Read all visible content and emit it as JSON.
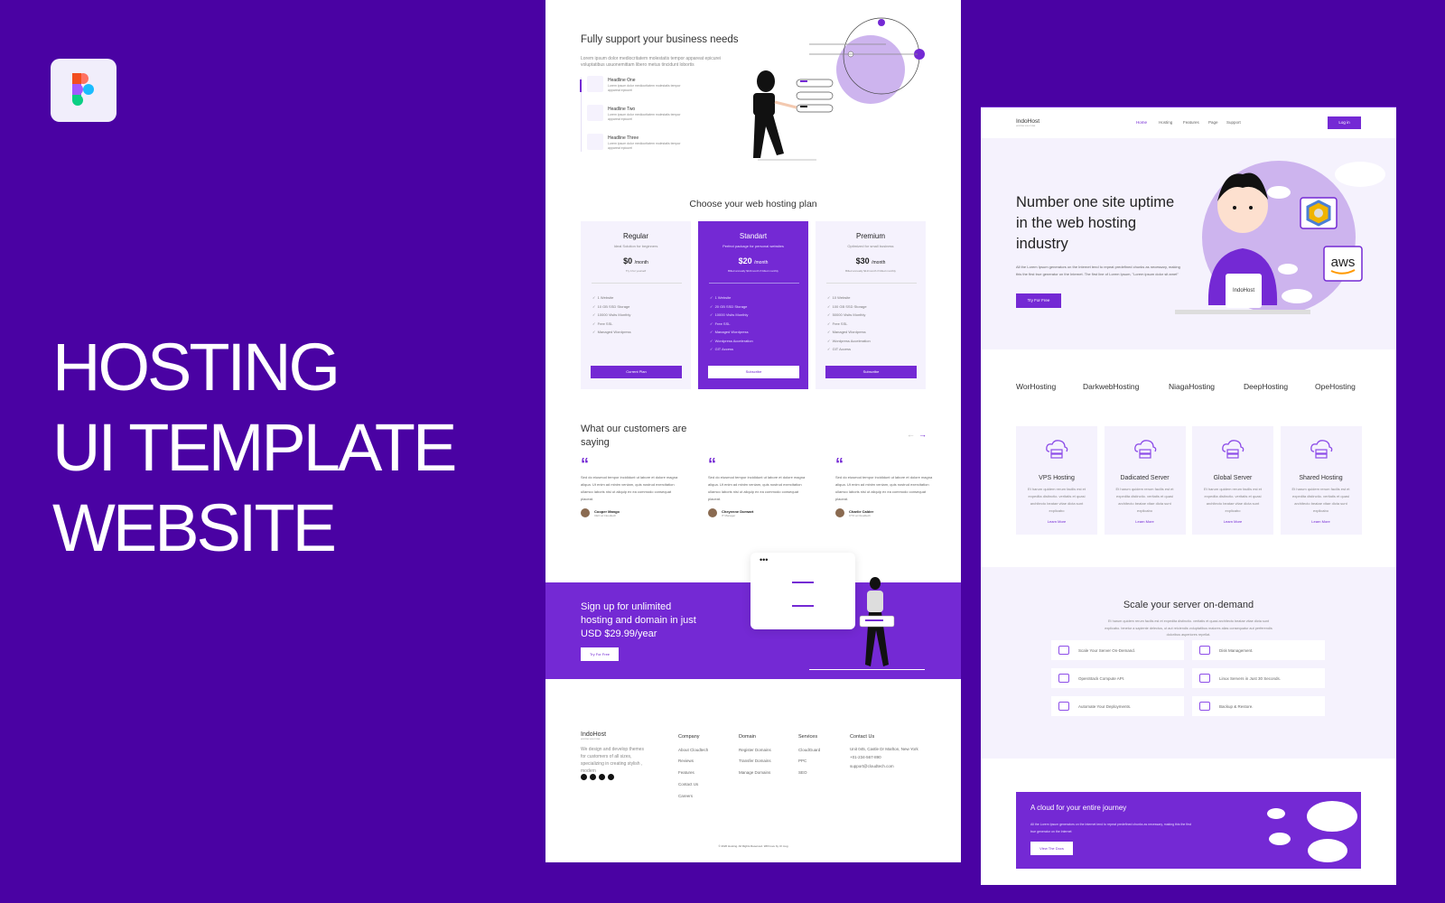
{
  "cover": {
    "title_lines": [
      "HOSTING",
      "UI TEMPLATE",
      "WEBSITE"
    ],
    "logo_icon": "figma-logo-icon",
    "bg_color": "#4a02a3",
    "accent": "#7429d4"
  },
  "page1": {
    "support": {
      "title": "Fully support your business needs",
      "desc": "Lorem ipsum dolor mediocritatem molestatis tempor appareat epicurei voluptatibus usuonemittam libero metus tincidunt lobortis",
      "items": [
        {
          "title": "Headline One",
          "desc": "Lorem ipsum dolor mediocritatem molestatis tempor appareat epicurei"
        },
        {
          "title": "Headline Two",
          "desc": "Lorem ipsum dolor mediocritatem molestatis tempor appareat epicurei"
        },
        {
          "title": "Headline Three",
          "desc": "Lorem ipsum dolor mediocritatem molestatis tempor appareat epicurei"
        }
      ]
    },
    "plans": {
      "title": "Choose your web hosting plan",
      "items": [
        {
          "name": "Regular",
          "sub": "Ideal Solution for beginners",
          "price": "$0",
          "per": "/month",
          "note": "Try it for yourself",
          "features": [
            "1 Website",
            "10 GB SSD Storage",
            "10000 Visits Monthly",
            "Free SSL",
            "Managed Wordpress"
          ],
          "button": "Current Plan"
        },
        {
          "name": "Standart",
          "sub": "Perfect package for personal websites",
          "price": "$20",
          "per": "/month",
          "note": "Billed annually $10/month if billed monthly",
          "features": [
            "1 Website",
            "20 GB SSD Storage",
            "10000 Visits Monthly",
            "Free SSL",
            "Managed Wordpress",
            "Wordpress Acceleration",
            "GIT Access"
          ],
          "button": "Subscribe"
        },
        {
          "name": "Premium",
          "sub": "Optimized for small business",
          "price": "$30",
          "per": "/month",
          "note": "Billed annually $12/month if billed monthly",
          "features": [
            "10 Website",
            "100 GB SSD Storage",
            "50000 Visits Monthly",
            "Free SSL",
            "Managed Wordpress",
            "Wordpress Acceleration",
            "GIT Access"
          ],
          "button": "Subscribe"
        }
      ]
    },
    "testimonials": {
      "title_l1": "What our customers are",
      "title_l2": "saying",
      "quote": "“",
      "items": [
        {
          "text": "Sed do eiusmod tempor incididunt ut labore et dolore magna aliqua. Ut enim ad minim veniam, quis nostrud exercitation ullamco laboris nisi ut aliquip ex ea commodo consequat placeat.",
          "name": "Cooper Mango",
          "role": "CEO at Cloudtech"
        },
        {
          "text": "Sed do eiusmod tempor incididunt ut labore et dolore magna aliqua. Ut enim ad minim veniam, quis nostrud exercitation ullamco laboris nisi ut aliquip ex ea commodo consequat placeat.",
          "name": "Cheyenne Dorwart",
          "role": "IT Manager"
        },
        {
          "text": "Sed do eiusmod tempor incididunt ut labore et dolore magna aliqua. Ut enim ad minim veniam, quis nostrud exercitation ullamco laboris nisi ut aliquip ex ea commodo consequat placeat.",
          "name": "Charlie Calder",
          "role": "CTO at Cloudtech"
        }
      ]
    },
    "signup": {
      "l1": "Sign up for unlimited",
      "l2": "hosting and domain in just",
      "l3": "USD $29.99/year",
      "button": "Try For Free"
    },
    "footer": {
      "brand": "IndoHost",
      "tagline": "HOSTING SOLUTIONS",
      "desc": "We design and develop themes for customers of all sizes, specializing in creating stylish , modern",
      "social": [
        "facebook-icon",
        "twitter-icon",
        "linkedin-icon",
        "youtube-icon"
      ],
      "columns": [
        {
          "title": "Company",
          "links": [
            "About Cloudtech",
            "Reviews",
            "Features",
            "Contact Us",
            "Careers"
          ]
        },
        {
          "title": "Domain",
          "links": [
            "Register Domains",
            "Transfer Domains",
            "Manage Domains"
          ]
        },
        {
          "title": "Services",
          "links": [
            "CloudGuard",
            "PPC",
            "SEO"
          ]
        },
        {
          "title": "Contact Us",
          "links": [
            "Unit 045, Castle Dr Marlton, New York",
            "+01-234-567-890",
            "support@cloudtech.com"
          ]
        }
      ],
      "copyright": "© 2020 Hosting. All Rights Reserved. With love by UI mug"
    }
  },
  "page2": {
    "nav": {
      "brand": "IndoHost",
      "tagline": "HOSTING SOLUTIONS",
      "links": [
        "Home",
        "Hosting",
        "Features",
        "Page",
        "Support"
      ],
      "login": "Log in"
    },
    "hero": {
      "l1": "Number one site uptime",
      "l2": "in the web hosting",
      "l3": "industry",
      "desc": "All the Lorem Ipsum generators on the Internet tend to repeat predefined chunks as necessary, making this the first true generator on the Internet. The first line of Lorem Ipsum, \"Lorem ipsum dolor sit amet\"",
      "button": "Try For Free",
      "card_brand": "IndoHost",
      "badge_aws": "aws"
    },
    "brands": [
      "WorHosting",
      "DarkwebHosting",
      "NiagaHosting",
      "DeepHosting",
      "OpeHosting"
    ],
    "services": [
      {
        "name": "VPS Hosting",
        "desc": "Et harum quidem rerum facilis est et expedita distinctio. veritatis et quasi architecto beatae vitae dicta sunt explicabo",
        "link": "Learn More",
        "icon": "cloud-server-icon"
      },
      {
        "name": "Dadicated Server",
        "desc": "Et harum quidem rerum facilis est et expedita distinctio. veritatis et quasi architecto beatae vitae dicta sunt explicabo",
        "link": "Learn More",
        "icon": "server-rack-icon"
      },
      {
        "name": "Global Server",
        "desc": "Et harum quidem rerum facilis est et expedita distinctio. veritatis et quasi architecto beatae vitae dicta sunt explicabo",
        "link": "Learn More",
        "icon": "global-server-icon"
      },
      {
        "name": "Shared Hosting",
        "desc": "Et harum quidem rerum facilis est et expedita distinctio. veritatis et quasi architecto beatae vitae dicta sunt explicabo",
        "link": "Learn More",
        "icon": "cloud-network-icon"
      }
    ],
    "scale": {
      "title": "Scale your server on-demand",
      "desc": "Et harum quidem rerum facilis est et expedita distinctio. veritatis et quasi architecto beatae vitae dicta sunt explicabo. tenetur a sapiente delectus, ut aut reiciendis voluptatibus maiores alias consequatur aut perferendis doloribus asperiores repellat.",
      "features": [
        "Scale Your Server On-Demand.",
        "Disk Management.",
        "OpenStack Compute API.",
        "Linux Servers in Just 30 Seconds.",
        "Automate Your Deployments.",
        "Backup & Restore."
      ]
    },
    "cta": {
      "title": "A cloud for your entire journey",
      "desc": "All the Lorem Ipsum generators on the Internet tend to repeat predefined chunks as necessary, making this the first true generator on the Internet",
      "button": "View The Docs"
    }
  }
}
